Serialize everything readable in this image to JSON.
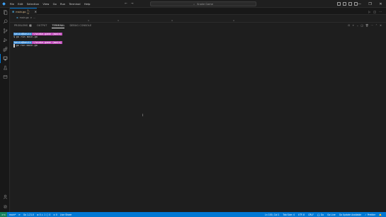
{
  "titlebar": {
    "menu": [
      "File",
      "Edit",
      "Selection",
      "View",
      "Go",
      "Run",
      "Terminal",
      "Help"
    ],
    "command_center": "Snake Game",
    "window_controls": [
      "—",
      "❐",
      "✕"
    ]
  },
  "tab": {
    "filename": "main.go",
    "badge": "1, U",
    "close": "✕"
  },
  "breadcrumb": {
    "file": "main.go",
    "separator": ">",
    "more": "..."
  },
  "panel": {
    "tabs": [
      {
        "label": "PROBLEMS",
        "count": "1"
      },
      {
        "label": "OUTPUT"
      },
      {
        "label": "TERMINAL"
      },
      {
        "label": "DEBUG CONSOLE"
      }
    ],
    "active_tab": "TERMINAL"
  },
  "terminal": {
    "blocks": [
      {
        "user": "kevin@kevin",
        "path": "~/snake-game (main)",
        "symbol": "$",
        "command": "go run main.go"
      },
      {
        "user": "kevin@kevin",
        "path": "~/snake-game (main)",
        "symbol": "$",
        "command": "go run main.go"
      }
    ]
  },
  "statusbar": {
    "remote": "><",
    "branch": "main*",
    "sync": "⟳",
    "go_version": "Go 1.21.0",
    "problems": "⊗ 0 ⚠ 1 ⓘ 0",
    "ports": "⊘ 0",
    "liveshare": "Live Share",
    "position": "Ln 100, Col 1",
    "tab_size": "Tab Size: 4",
    "encoding": "UTF-8",
    "eol": "CRLF",
    "language": "{} Go",
    "go_live": "Go Live",
    "golang_status": "Go Update Available",
    "prettier": "✓ Prettier",
    "notifications": "🔔"
  }
}
